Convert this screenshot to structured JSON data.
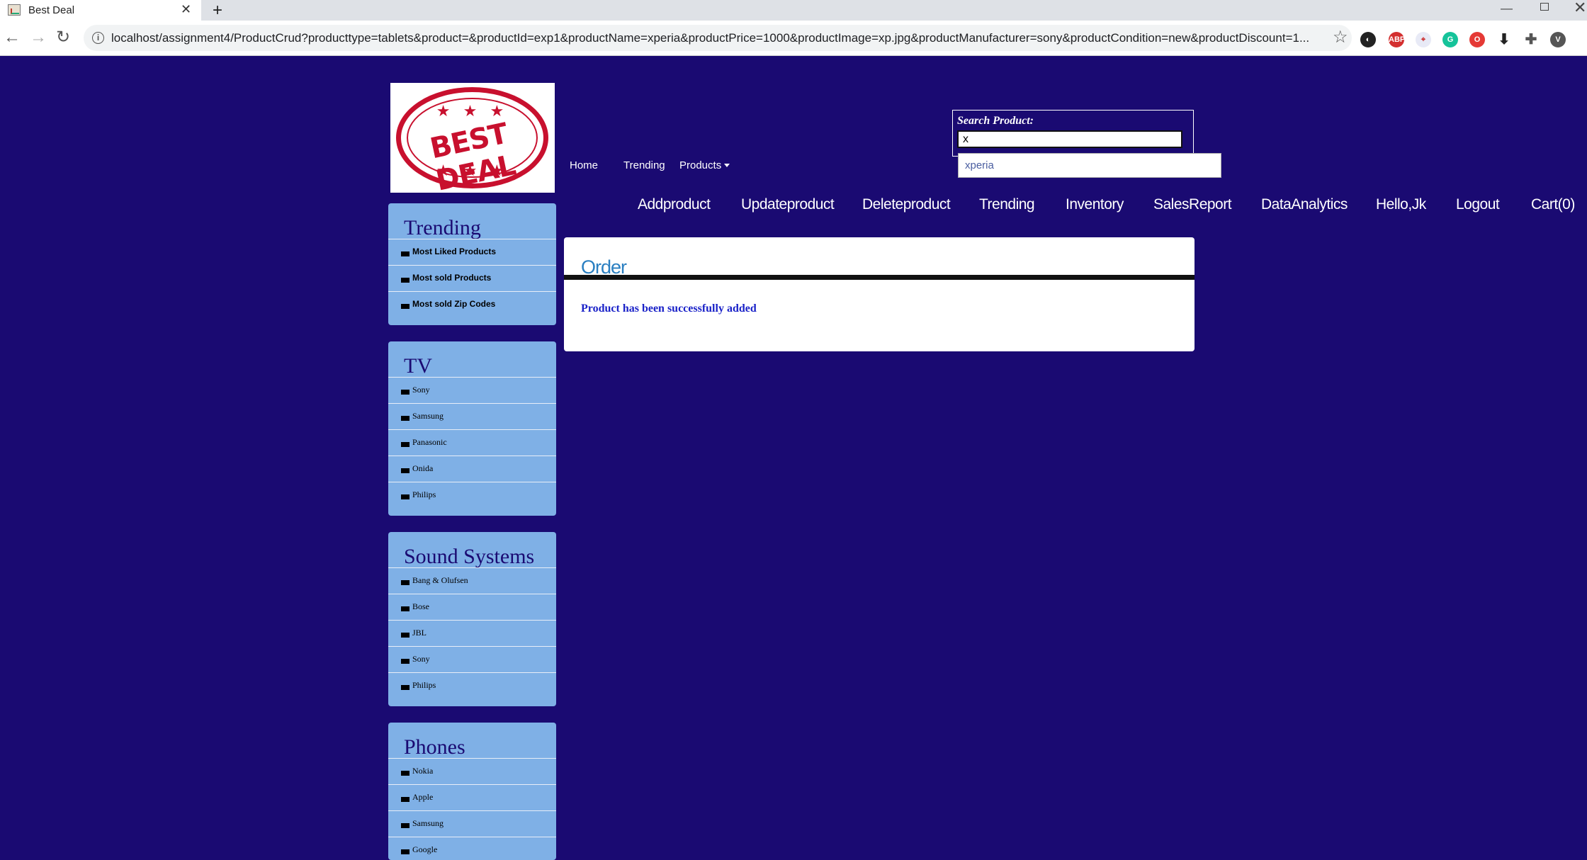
{
  "browser": {
    "tab_title": "Best Deal",
    "url": "localhost/assignment4/ProductCrud?producttype=tablets&product=&productId=exp1&productName=xperia&productPrice=1000&productImage=xp.jpg&productManufacturer=sony&productCondition=new&productDiscount=1...",
    "profile_initial": "V"
  },
  "logo": {
    "text": "BEST DEAL"
  },
  "topnav": {
    "home": "Home",
    "trending": "Trending",
    "products": "Products"
  },
  "search": {
    "label": "Search Product:",
    "value": "x",
    "suggestion": "xperia"
  },
  "adminnav": [
    "Addproduct",
    "Updateproduct",
    "Deleteproduct",
    "Trending",
    "Inventory",
    "SalesReport",
    "DataAnalytics",
    "Hello,Jk",
    "Logout",
    "Cart(0)"
  ],
  "sidebar": {
    "trending": {
      "title": "Trending",
      "items": [
        "Most Liked Products",
        "Most sold Products",
        "Most sold Zip Codes"
      ]
    },
    "tv": {
      "title": "TV",
      "items": [
        "Sony",
        "Samsung",
        "Panasonic",
        "Onida",
        "Philips"
      ]
    },
    "sound": {
      "title": "Sound Systems",
      "items": [
        "Bang & Olufsen",
        "Bose",
        "JBL",
        "Sony",
        "Philips"
      ]
    },
    "phones": {
      "title": "Phones",
      "items": [
        "Nokia",
        "Apple",
        "Samsung",
        "Google"
      ]
    }
  },
  "content": {
    "title": "Order",
    "message": "Product has been successfully added"
  },
  "colors": {
    "page_bg": "#1a0a72",
    "sidebar_bg": "#7fb0e6",
    "order_title": "#2a7fc1",
    "message": "#1a22c8",
    "logo_red": "#c8102e"
  }
}
